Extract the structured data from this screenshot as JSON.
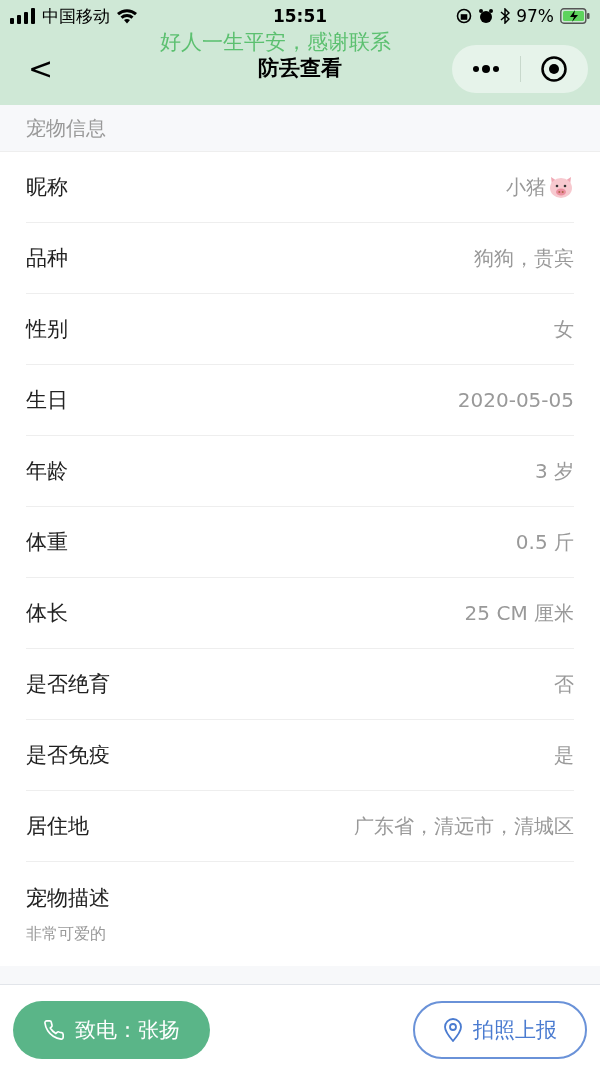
{
  "status_bar": {
    "carrier": "中国移动",
    "time": "15:51",
    "battery": "97%"
  },
  "nav": {
    "banner": "好人一生平安，感谢联系",
    "title": "防丢查看",
    "back": "<"
  },
  "section_title": "宠物信息",
  "fields": [
    {
      "kind": "pair",
      "label": "昵称",
      "value": "小猪",
      "pig": true
    },
    {
      "kind": "pair",
      "label": "品种",
      "value": "狗狗，贵宾"
    },
    {
      "kind": "pair",
      "label": "性别",
      "value": "女"
    },
    {
      "kind": "pair",
      "label": "生日",
      "value": "2020-05-05"
    },
    {
      "kind": "pair",
      "label": "年龄",
      "value": "3 岁"
    },
    {
      "kind": "pair",
      "label": "体重",
      "value": "0.5 斤"
    },
    {
      "kind": "pair",
      "label": "体长",
      "value": "25 CM 厘米"
    },
    {
      "kind": "pair",
      "label": "是否绝育",
      "value": "否"
    },
    {
      "kind": "pair",
      "label": "是否免疫",
      "value": "是"
    },
    {
      "kind": "pair",
      "label": "居住地",
      "value": "广东省，清远市，清城区"
    },
    {
      "kind": "block",
      "label": "宠物描述",
      "value": "非常可爱的"
    }
  ],
  "actions": [
    {
      "kind": "call",
      "label": "致电：张扬"
    },
    {
      "kind": "report",
      "label": "拍照上报"
    }
  ]
}
